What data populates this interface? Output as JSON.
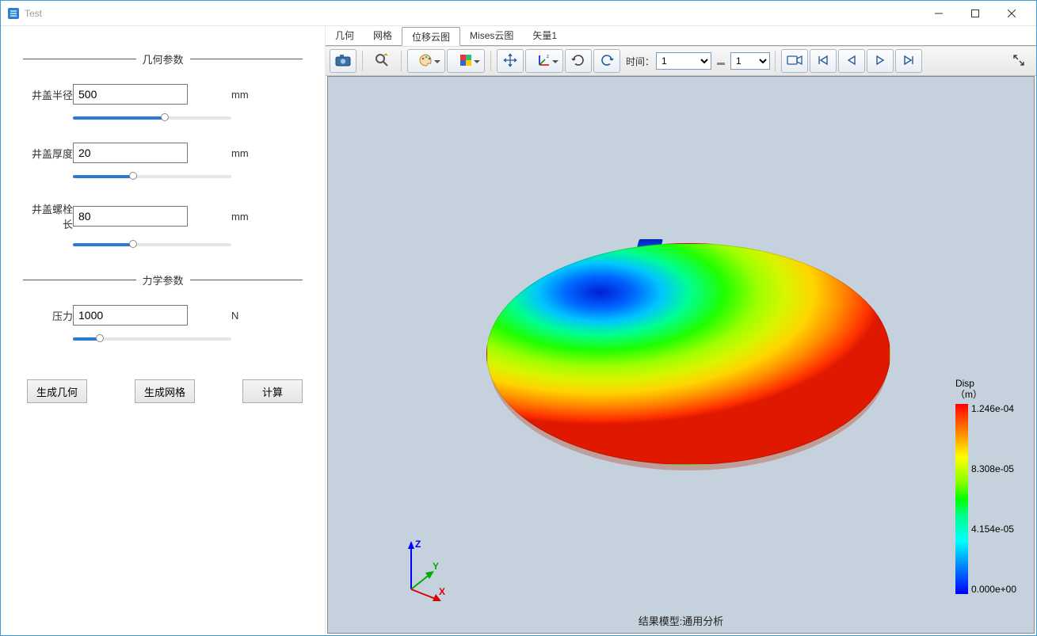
{
  "window": {
    "title": "Test"
  },
  "sidebar": {
    "group1_title": "几何参数",
    "group2_title": "力学参数",
    "params": {
      "radius": {
        "label": "井盖半径",
        "value": "500",
        "unit": "mm",
        "fill_pct": 58
      },
      "thickness": {
        "label": "井盖厚度",
        "value": "20",
        "unit": "mm",
        "fill_pct": 38
      },
      "bolt_len": {
        "label": "井盖螺栓长",
        "value": "80",
        "unit": "mm",
        "fill_pct": 38
      },
      "pressure": {
        "label": "压力",
        "value": "1000",
        "unit": "N",
        "fill_pct": 17
      }
    },
    "buttons": {
      "gen_geom": "生成几何",
      "gen_mesh": "生成网格",
      "compute": "计算"
    }
  },
  "tabs": [
    "几何",
    "网格",
    "位移云图",
    "Mises云图",
    "矢量1"
  ],
  "active_tab": "位移云图",
  "toolbar": {
    "time_label": "时间：",
    "time_value": "1",
    "step_value": "1"
  },
  "legend": {
    "title_line1": "Disp",
    "title_line2": "（m）",
    "ticks": [
      "1.246e-04",
      "8.308e-05",
      "4.154e-05",
      "0.000e+00"
    ]
  },
  "viewport": {
    "footer": "结果模型:通用分析",
    "axes": {
      "x": "X",
      "y": "Y",
      "z": "Z"
    }
  }
}
